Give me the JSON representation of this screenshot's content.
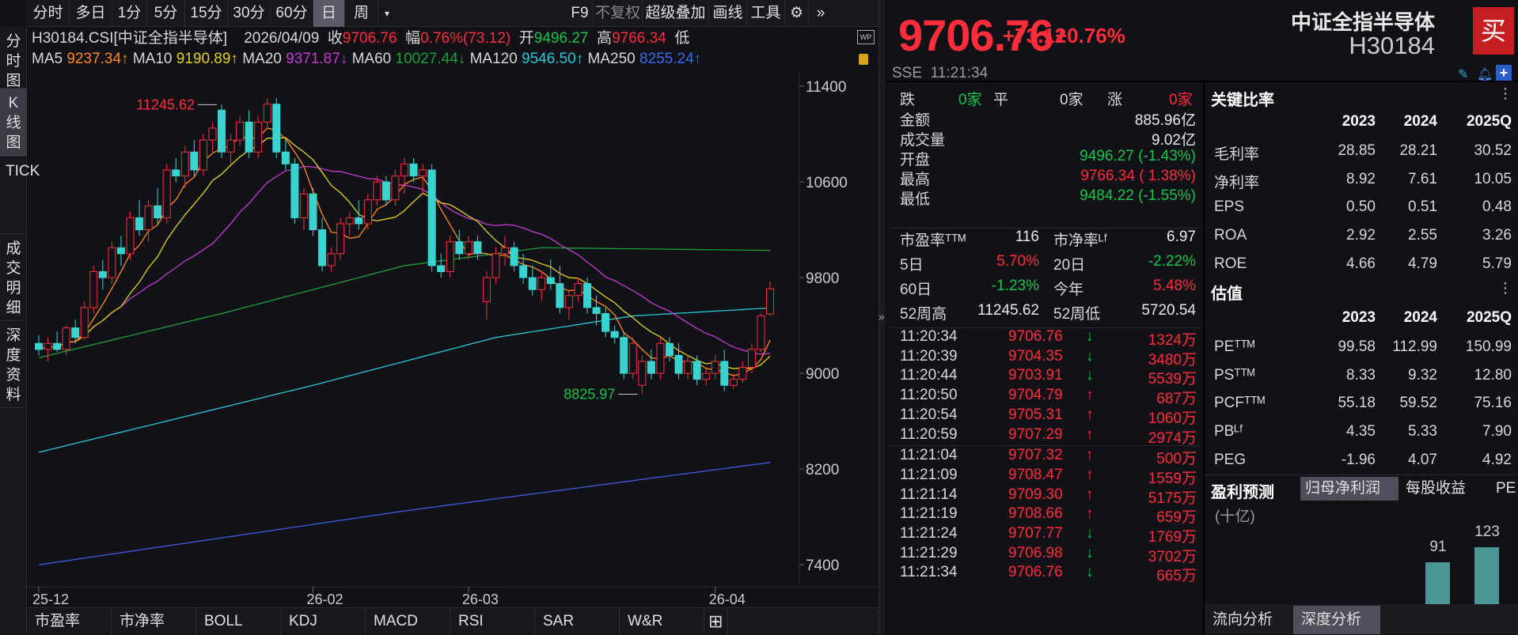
{
  "toolbar": {
    "periods": [
      "分时",
      "多日",
      "1分",
      "5分",
      "15分",
      "30分",
      "60分",
      "日",
      "周"
    ],
    "selected": "日",
    "tools": [
      "F9",
      "不复权",
      "超级叠加",
      "画线",
      "工具"
    ]
  },
  "sidebar": {
    "items": [
      "分时图",
      "K线图",
      "TICK",
      "成交明细",
      "深度资料"
    ],
    "selected": "K线图"
  },
  "info": {
    "code": "H30184.CSI[中证全指半导体]",
    "date": "2026/04/09",
    "close_label": "收",
    "close": "9706.76",
    "amp_label": "幅",
    "amp": "0.76%(73.12)",
    "open_label": "开",
    "open": "9496.27",
    "high_label": "高",
    "high": "9766.34",
    "low_label": "低"
  },
  "ma": [
    {
      "label": "MA5",
      "value": "9237.34↑",
      "color": "#ff8a1e"
    },
    {
      "label": "MA10",
      "value": "9190.89↑",
      "color": "#e6d21a"
    },
    {
      "label": "MA20",
      "value": "9371.87↓",
      "color": "#c93bd0"
    },
    {
      "label": "MA60",
      "value": "10027.44↓",
      "color": "#1aa03a"
    },
    {
      "label": "MA120",
      "value": "9546.50↑",
      "color": "#28c8d8"
    },
    {
      "label": "MA250",
      "value": "8255.24↑",
      "color": "#3b6af0"
    }
  ],
  "chart_data": {
    "type": "candlestick",
    "yticks": [
      11400,
      10600,
      9800,
      9000,
      8200,
      7400
    ],
    "ylim": [
      7240,
      11560
    ],
    "xticks": [
      {
        "i": 0,
        "label": "25-12"
      },
      {
        "i": 30,
        "label": "26-02"
      },
      {
        "i": 47,
        "label": "26-03"
      },
      {
        "i": 74,
        "label": "26-04"
      }
    ],
    "annotations": [
      {
        "i": 20,
        "value": "11245.62",
        "side": "left",
        "color": "#ff2d3b"
      },
      {
        "i": 66,
        "value": "8825.97",
        "side": "left",
        "color": "#19c54a"
      }
    ],
    "ohlc": [
      [
        9250,
        9320,
        9150,
        9200
      ],
      [
        9200,
        9300,
        9100,
        9250
      ],
      [
        9250,
        9350,
        9180,
        9200
      ],
      [
        9200,
        9400,
        9150,
        9380
      ],
      [
        9380,
        9450,
        9250,
        9300
      ],
      [
        9300,
        9600,
        9280,
        9550
      ],
      [
        9550,
        9900,
        9500,
        9850
      ],
      [
        9850,
        9950,
        9700,
        9800
      ],
      [
        9800,
        10100,
        9750,
        10050
      ],
      [
        10050,
        10150,
        9900,
        10000
      ],
      [
        10000,
        10350,
        9950,
        10300
      ],
      [
        10300,
        10450,
        10150,
        10200
      ],
      [
        10200,
        10450,
        10100,
        10400
      ],
      [
        10400,
        10550,
        10250,
        10300
      ],
      [
        10300,
        10750,
        10250,
        10700
      ],
      [
        10700,
        10800,
        10600,
        10650
      ],
      [
        10650,
        10900,
        10550,
        10850
      ],
      [
        10850,
        10950,
        10650,
        10700
      ],
      [
        10700,
        11000,
        10650,
        10950
      ],
      [
        10950,
        11100,
        10850,
        11050
      ],
      [
        11200,
        11245.62,
        10800,
        10850
      ],
      [
        10850,
        11000,
        10750,
        10950
      ],
      [
        10950,
        11150,
        10900,
        11100
      ],
      [
        11100,
        11200,
        10800,
        10850
      ],
      [
        10850,
        11150,
        10800,
        11100
      ],
      [
        11100,
        11300,
        11050,
        11250
      ],
      [
        11250,
        11300,
        10800,
        10850
      ],
      [
        10850,
        10950,
        10700,
        10750
      ],
      [
        10750,
        10800,
        10250,
        10300
      ],
      [
        10300,
        10550,
        10200,
        10500
      ],
      [
        10500,
        10550,
        10150,
        10200
      ],
      [
        10200,
        10300,
        9850,
        9900
      ],
      [
        9900,
        10050,
        9850,
        10000
      ],
      [
        10000,
        10300,
        9950,
        10250
      ],
      [
        10250,
        10350,
        10150,
        10300
      ],
      [
        10300,
        10450,
        10200,
        10250
      ],
      [
        10250,
        10500,
        10200,
        10450
      ],
      [
        10450,
        10650,
        10400,
        10600
      ],
      [
        10600,
        10650,
        10400,
        10450
      ],
      [
        10450,
        10700,
        10400,
        10650
      ],
      [
        10650,
        10800,
        10500,
        10750
      ],
      [
        10750,
        10800,
        10600,
        10650
      ],
      [
        10650,
        10750,
        10500,
        10700
      ],
      [
        10700,
        10750,
        9850,
        9900
      ],
      [
        9900,
        10000,
        9800,
        9850
      ],
      [
        9850,
        10150,
        9800,
        10100
      ],
      [
        10100,
        10200,
        9950,
        10000
      ],
      [
        10000,
        10150,
        9950,
        10100
      ],
      [
        10100,
        10150,
        9950,
        10000
      ],
      [
        9600,
        9850,
        9450,
        9800
      ],
      [
        9800,
        10050,
        9750,
        10000
      ],
      [
        10000,
        10150,
        9900,
        10050
      ],
      [
        10050,
        10100,
        9850,
        9900
      ],
      [
        9900,
        10000,
        9750,
        9800
      ],
      [
        9800,
        9900,
        9650,
        9700
      ],
      [
        9700,
        9850,
        9600,
        9800
      ],
      [
        9800,
        9950,
        9700,
        9750
      ],
      [
        9750,
        9900,
        9500,
        9550
      ],
      [
        9550,
        9700,
        9450,
        9650
      ],
      [
        9650,
        9800,
        9600,
        9750
      ],
      [
        9750,
        9800,
        9500,
        9550
      ],
      [
        9550,
        9650,
        9400,
        9500
      ],
      [
        9500,
        9550,
        9300,
        9350
      ],
      [
        9350,
        9400,
        9250,
        9300
      ],
      [
        9300,
        9350,
        8950,
        9000
      ],
      [
        9000,
        9300,
        8950,
        9250
      ],
      [
        8900,
        9150,
        8825.97,
        9100
      ],
      [
        9100,
        9200,
        8950,
        9000
      ],
      [
        9000,
        9300,
        8950,
        9250
      ],
      [
        9250,
        9300,
        9100,
        9150
      ],
      [
        9150,
        9250,
        8950,
        9000
      ],
      [
        9000,
        9150,
        8950,
        9100
      ],
      [
        9100,
        9150,
        8900,
        8950
      ],
      [
        8950,
        9050,
        8900,
        9000
      ],
      [
        9000,
        9150,
        8950,
        9100
      ],
      [
        9100,
        9200,
        8850,
        8900
      ],
      [
        8900,
        9000,
        8870,
        8950
      ],
      [
        8950,
        9100,
        8920,
        9050
      ],
      [
        9050,
        9250,
        9000,
        9200
      ],
      [
        9200,
        9500,
        9180,
        9480
      ],
      [
        9496.27,
        9766.34,
        9484.22,
        9706.76
      ]
    ],
    "ma60": [
      [
        0,
        9130
      ],
      [
        20,
        9500
      ],
      [
        40,
        9900
      ],
      [
        55,
        10050
      ],
      [
        80,
        10027.44
      ]
    ],
    "ma120": [
      [
        0,
        8340
      ],
      [
        30,
        8900
      ],
      [
        50,
        9300
      ],
      [
        65,
        9480
      ],
      [
        80,
        9546.5
      ]
    ],
    "ma250": [
      [
        0,
        7400
      ],
      [
        40,
        7850
      ],
      [
        80,
        8255.24
      ]
    ]
  },
  "bottom_tabs": [
    "市盈率",
    "市净率",
    "BOLL",
    "KDJ",
    "MACD",
    "RSI",
    "SAR",
    "W&R",
    "⊞"
  ],
  "quote": {
    "price": "9706.76",
    "change": "+73.12",
    "pct": "+0.76%",
    "name": "中证全指半导体",
    "code": "H30184",
    "buy": "买",
    "exchange": "SSE",
    "time": "11:21:34",
    "breadth": {
      "down_label": "跌",
      "down": "0家",
      "flat_label": "平",
      "flat": "0家",
      "up_label": "涨",
      "up": "0家"
    },
    "stats": [
      {
        "label": "金额",
        "value": "885.96亿",
        "color": "#e8e8e8"
      },
      {
        "label": "成交量",
        "value": "9.02亿",
        "color": "#e8e8e8"
      },
      {
        "label": "开盘",
        "value": "9496.27 (-1.43%)",
        "color": "#19c54a"
      },
      {
        "label": "最高",
        "value": "9766.34 ( 1.38%)",
        "color": "#ff2d3b"
      },
      {
        "label": "最低",
        "value": "9484.22 (-1.55%)",
        "color": "#19c54a"
      }
    ],
    "pairs": [
      [
        {
          "label": "市盈率ᵀᵀᴹ",
          "value": "116",
          "color": "#e8e8e8"
        },
        {
          "label": "市净率ᴸᶠ",
          "value": "6.97",
          "color": "#e8e8e8"
        }
      ],
      [
        {
          "label": "5日",
          "value": "5.70%",
          "color": "#ff2d3b"
        },
        {
          "label": "20日",
          "value": "-2.22%",
          "color": "#19c54a"
        }
      ],
      [
        {
          "label": "60日",
          "value": "-1.23%",
          "color": "#19c54a"
        },
        {
          "label": "今年",
          "value": "5.48%",
          "color": "#ff2d3b"
        }
      ],
      [
        {
          "label": "52周高",
          "value": "11245.62",
          "color": "#e8e8e8"
        },
        {
          "label": "52周低",
          "value": "5720.54",
          "color": "#e8e8e8"
        }
      ]
    ],
    "ticks": [
      [
        "11:20:34",
        "9706.76",
        "down",
        "1324万"
      ],
      [
        "11:20:39",
        "9704.35",
        "down",
        "3480万"
      ],
      [
        "11:20:44",
        "9703.91",
        "down",
        "5539万"
      ],
      [
        "11:20:50",
        "9704.79",
        "up",
        "687万"
      ],
      [
        "11:20:54",
        "9705.31",
        "up",
        "1060万"
      ],
      [
        "11:20:59",
        "9707.29",
        "up",
        "2974万"
      ],
      [
        "11:21:04",
        "9707.32",
        "up",
        "500万"
      ],
      [
        "11:21:09",
        "9708.47",
        "up",
        "1559万"
      ],
      [
        "11:21:14",
        "9709.30",
        "up",
        "5175万"
      ],
      [
        "11:21:19",
        "9708.66",
        "up",
        "659万"
      ],
      [
        "11:21:24",
        "9707.77",
        "down",
        "1769万"
      ],
      [
        "11:21:29",
        "9706.98",
        "down",
        "3702万"
      ],
      [
        "11:21:34",
        "9706.76",
        "down",
        "665万"
      ]
    ]
  },
  "ratios": {
    "title": "关键比率",
    "years": [
      "2023",
      "2024",
      "2025Q"
    ],
    "rows": [
      [
        "毛利率",
        "28.85",
        "28.21",
        "30.52"
      ],
      [
        "净利率",
        "8.92",
        "7.61",
        "10.05"
      ],
      [
        "EPS",
        "0.50",
        "0.51",
        "0.48"
      ],
      [
        "ROA",
        "2.92",
        "2.55",
        "3.26"
      ],
      [
        "ROE",
        "4.66",
        "4.79",
        "5.79"
      ]
    ]
  },
  "valuation": {
    "title": "估值",
    "years": [
      "2023",
      "2024",
      "2025Q"
    ],
    "rows": [
      [
        "PEᵀᵀᴹ",
        "99.58",
        "112.99",
        "150.99"
      ],
      [
        "PSᵀᵀᴹ",
        "8.33",
        "9.32",
        "12.80"
      ],
      [
        "PCFᵀᵀᴹ",
        "55.18",
        "59.52",
        "75.16"
      ],
      [
        "PBᴸᶠ",
        "4.35",
        "5.33",
        "7.90"
      ],
      [
        "PEG",
        "-1.96",
        "4.07",
        "4.92"
      ]
    ]
  },
  "forecast": {
    "title": "盈利预测",
    "tabs": [
      "归母净利润",
      "每股收益",
      "PE"
    ],
    "unit": "(十亿)",
    "bars": [
      91,
      123
    ]
  },
  "right_tabs": [
    "流向分析",
    "深度分析"
  ]
}
